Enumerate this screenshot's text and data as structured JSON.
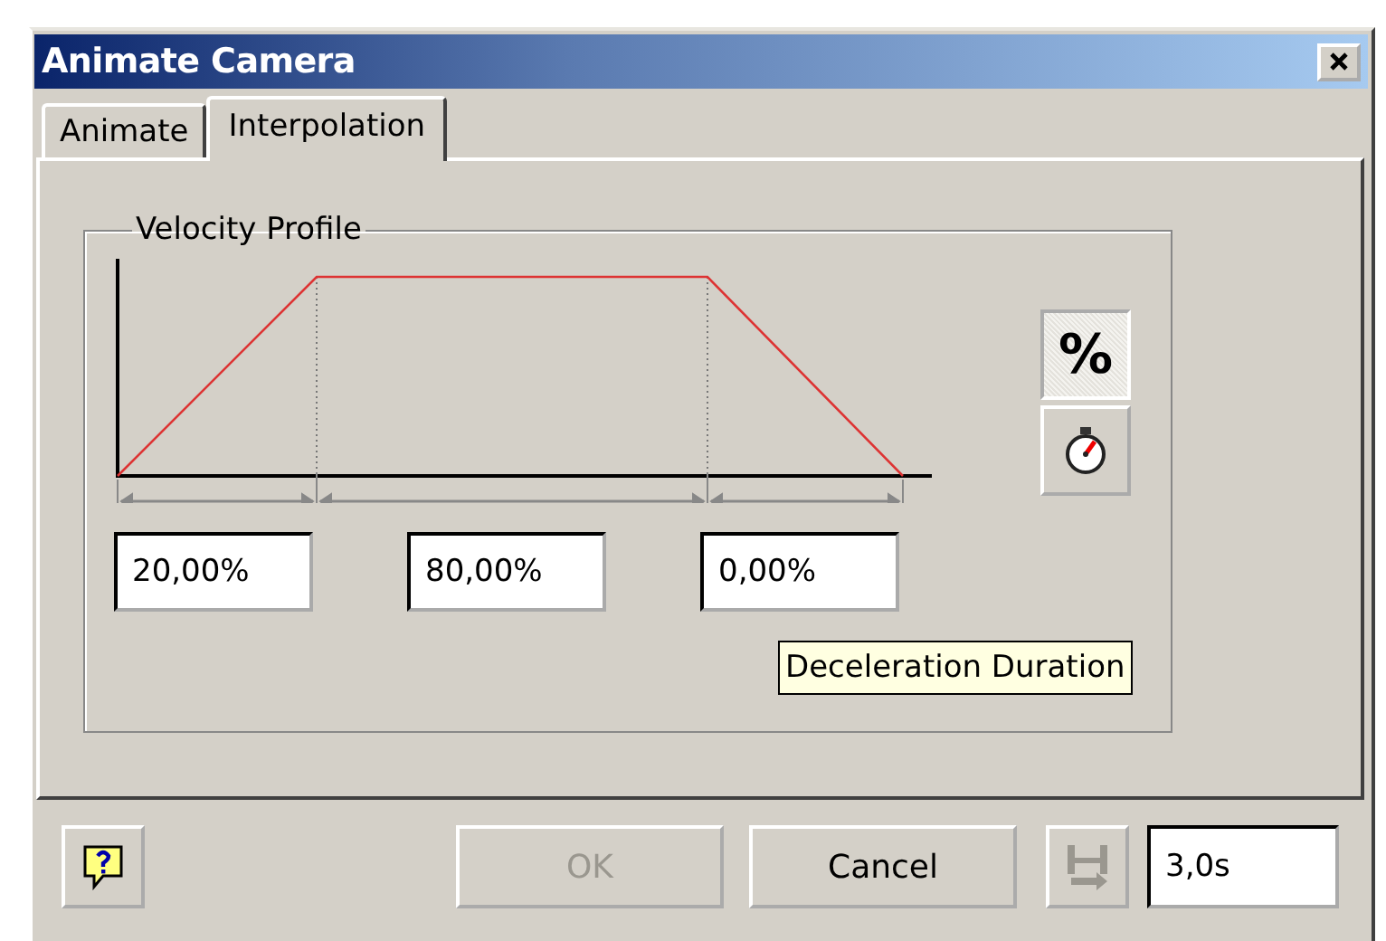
{
  "window": {
    "title": "Animate Camera"
  },
  "tabs": [
    {
      "label": "Animate",
      "selected": false
    },
    {
      "label": "Interpolation",
      "selected": true
    }
  ],
  "velocity_profile": {
    "title": "Velocity Profile",
    "fields": [
      {
        "value": "20,00%"
      },
      {
        "value": "80,00%"
      },
      {
        "value": "0,00%"
      }
    ],
    "unit_buttons": [
      {
        "kind": "percent",
        "label": "%",
        "selected": true
      },
      {
        "kind": "time",
        "selected": false
      }
    ],
    "tooltip": "Deceleration Duration"
  },
  "footer": [
    {
      "kind": "help"
    },
    {
      "kind": "text",
      "label": "OK",
      "disabled": true
    },
    {
      "kind": "text",
      "label": "Cancel",
      "disabled": false
    },
    {
      "kind": "play",
      "disabled": true
    },
    {
      "kind": "field",
      "value": "3,0s"
    }
  ]
}
